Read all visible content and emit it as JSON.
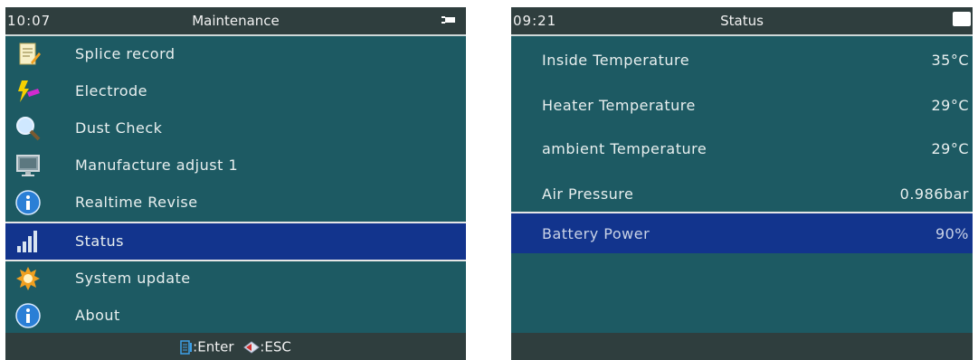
{
  "left": {
    "time": "10:07",
    "title": "Maintenance",
    "items": [
      {
        "label": "Splice record",
        "icon": "notepad-pencil-icon"
      },
      {
        "label": "Electrode",
        "icon": "lightning-electrode-icon"
      },
      {
        "label": "Dust Check",
        "icon": "magnifier-icon"
      },
      {
        "label": "Manufacture adjust 1",
        "icon": "monitor-icon"
      },
      {
        "label": "Realtime Revise",
        "icon": "info-icon"
      },
      {
        "label": "Status",
        "icon": "signal-bars-icon"
      },
      {
        "label": "System update",
        "icon": "gear-sun-icon"
      },
      {
        "label": "About",
        "icon": "info-icon"
      }
    ],
    "selected_index": 5,
    "footer": {
      "enter_label": ":Enter",
      "esc_label": ":ESC"
    }
  },
  "right": {
    "time": "09:21",
    "title": "Status",
    "rows": [
      {
        "label": "Inside Temperature",
        "value": "35°C"
      },
      {
        "label": "Heater Temperature",
        "value": "29°C"
      },
      {
        "label": "ambient Temperature",
        "value": "29°C"
      },
      {
        "label": "Air Pressure",
        "value": "0.986bar"
      },
      {
        "label": "Battery Power",
        "value": "90%"
      }
    ],
    "selected_index": 4
  },
  "colors": {
    "screen_bg": "#1d5a63",
    "bar_bg": "#2f3e3e",
    "selection": "#12348d"
  }
}
